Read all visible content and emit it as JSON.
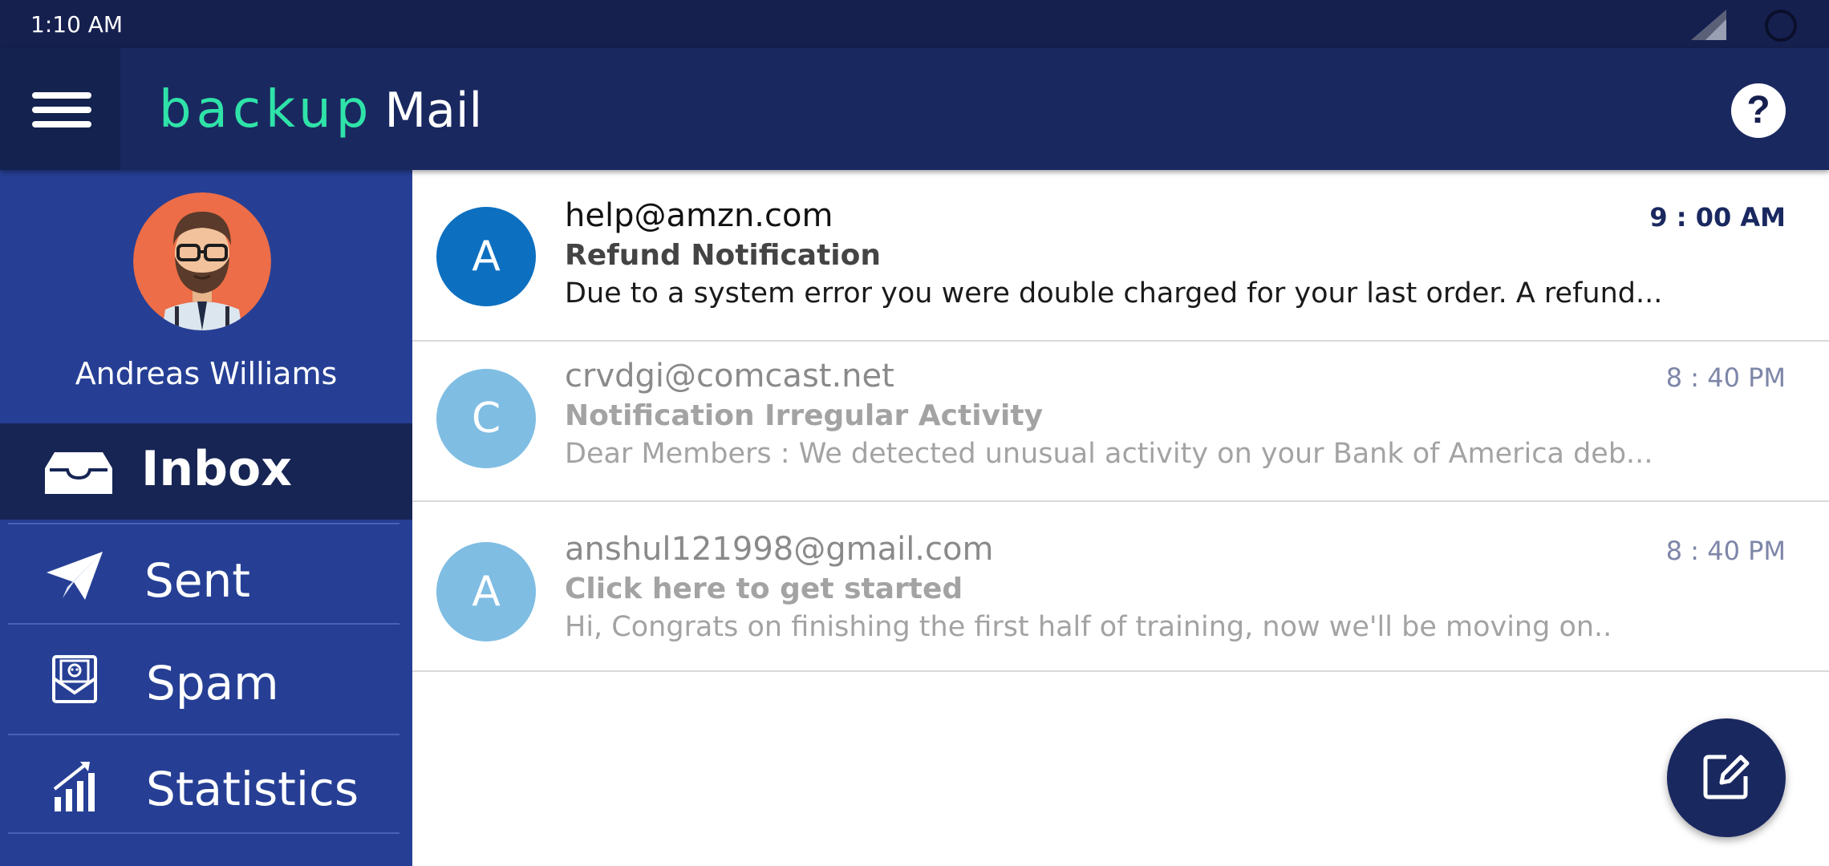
{
  "status_bar": {
    "time": "1:10 AM",
    "icons": [
      "signal-icon",
      "loading-icon"
    ]
  },
  "app_bar": {
    "logo_primary": "backup",
    "logo_secondary": "Mail",
    "help_label": "?",
    "icons": [
      "menu-icon",
      "help-icon"
    ]
  },
  "sidebar": {
    "user_name": "Andreas Williams",
    "items": [
      {
        "label": "Inbox",
        "icon": "inbox-icon",
        "active": true
      },
      {
        "label": "Sent",
        "icon": "paper-plane-icon",
        "active": false
      },
      {
        "label": "Spam",
        "icon": "spam-envelope-icon",
        "active": false
      },
      {
        "label": "Statistics",
        "icon": "bar-chart-icon",
        "active": false
      }
    ]
  },
  "emails": [
    {
      "avatar_letter": "A",
      "sender": "help@amzn.com",
      "subject": "Refund Notification",
      "preview": "Due to a system error you were double charged for your last order. A refund...",
      "time": "9 : 00 AM",
      "unread": true,
      "avatar_color": "#0d6fc0"
    },
    {
      "avatar_letter": "C",
      "sender": "crvdgi@comcast.net",
      "subject": "Notification Irregular Activity",
      "preview": "Dear Members : We detected unusual activity on your Bank of America deb...",
      "time": "8 : 40 PM",
      "unread": false,
      "avatar_color": "#7fbde3"
    },
    {
      "avatar_letter": "A",
      "sender": "anshul121998@gmail.com",
      "subject": "Click here to get started",
      "preview": "Hi, Congrats on finishing the first half of training, now we'll be moving on..",
      "time": "8 : 40 PM",
      "unread": false,
      "avatar_color": "#7fbde3"
    }
  ],
  "fab": {
    "icon": "compose-icon"
  },
  "colors": {
    "status_bar": "#16204f",
    "app_bar": "#1a2860",
    "sidebar": "#263f95",
    "sidebar_active": "#172554",
    "logo_accent": "#2fe3a8"
  }
}
